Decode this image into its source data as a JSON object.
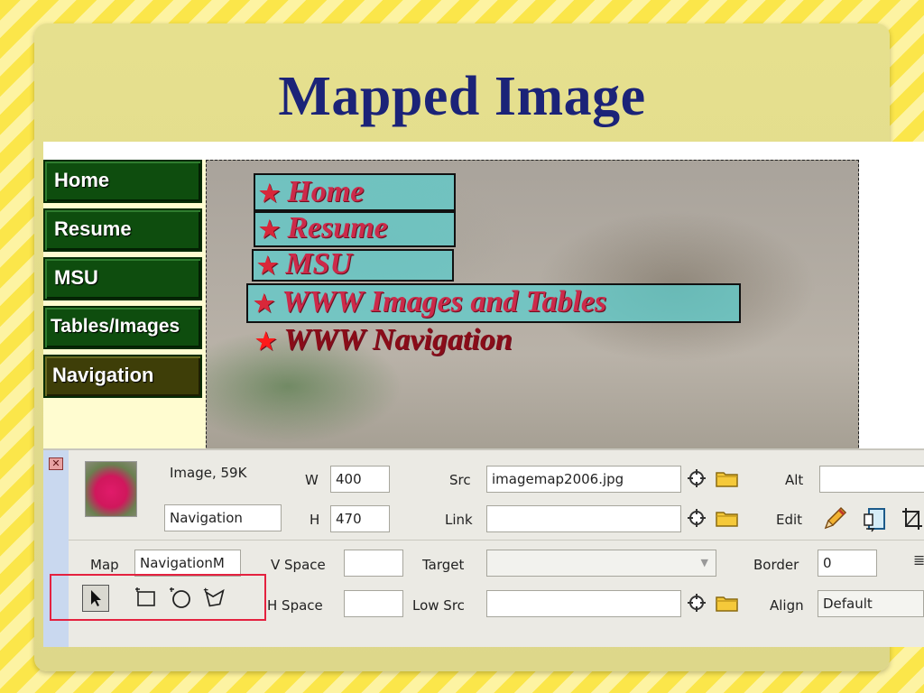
{
  "slide": {
    "title": "Mapped Image"
  },
  "nav": {
    "buttons": [
      "Home",
      "Resume",
      "MSU",
      "Tables/Images",
      "Navigation"
    ]
  },
  "image": {
    "hotspots": [
      {
        "label": "Home"
      },
      {
        "label": "Resume"
      },
      {
        "label": "MSU"
      },
      {
        "label": "WWW Images and Tables"
      }
    ],
    "current": "WWW Navigation"
  },
  "panel": {
    "type_label": "Image, 59K",
    "name_value": "Navigation",
    "w_label": "W",
    "w_value": "400",
    "h_label": "H",
    "h_value": "470",
    "src_label": "Src",
    "src_value": "imagemap2006.jpg",
    "link_label": "Link",
    "link_value": "",
    "alt_label": "Alt",
    "alt_value": "",
    "edit_label": "Edit",
    "map_label": "Map",
    "map_value": "NavigationM",
    "vspace_label": "V Space",
    "vspace_value": "",
    "hspace_label": "H Space",
    "hspace_value": "",
    "target_label": "Target",
    "target_value": "",
    "lowsrc_label": "Low Src",
    "lowsrc_value": "",
    "border_label": "Border",
    "border_value": "0",
    "align_label": "Align",
    "align_value": "Default"
  },
  "icons": {
    "close": "close-icon",
    "point_to_file": "crosshair-icon",
    "browse": "folder-icon",
    "edit": "pencil-icon",
    "optimize": "optimize-icon",
    "crop": "crop-icon",
    "pointer_tool": "pointer-hotspot-icon",
    "rect_tool": "rectangle-hotspot-icon",
    "oval_tool": "oval-hotspot-icon",
    "polygon_tool": "polygon-hotspot-icon"
  },
  "colors": {
    "title": "#1b2378",
    "nav_button": "#0e4d0e",
    "hotspot": "#5acdcd",
    "highlight_box": "#e4213f"
  }
}
